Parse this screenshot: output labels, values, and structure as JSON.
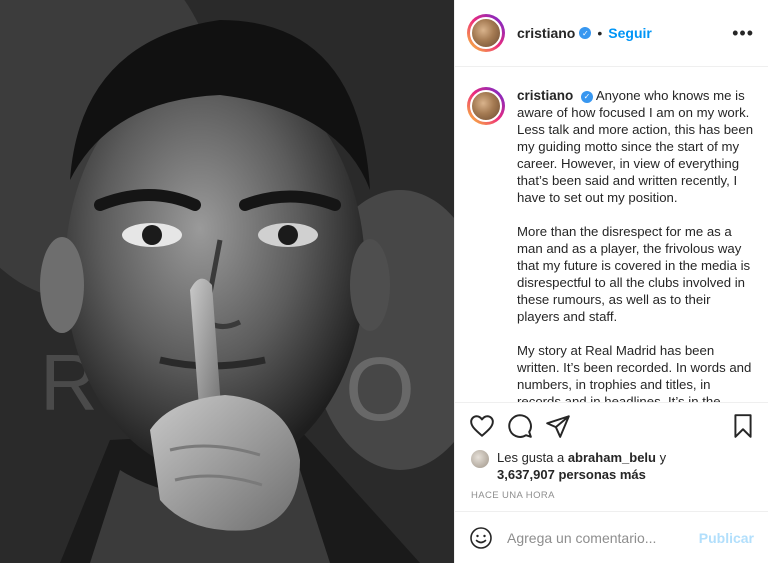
{
  "post": {
    "image_alt": "Photo of player in black and white with finger to lips"
  },
  "header": {
    "username": "cristiano",
    "separator": "•",
    "follow_label": "Seguir",
    "more_label": "•••",
    "verified_icon": "verified-badge-icon"
  },
  "caption": {
    "username": "cristiano",
    "paragraphs": [
      "Anyone who knows me is aware of how focused I am on my work. Less talk and more action, this has been my guiding motto since the start of my career. However, in view of everything that’s been said and written recently, I have to set out my position.",
      "More than the disrespect for me as a man and as a player, the frivolous way that my future is covered in the media is disrespectful to all the clubs involved in these rumours, as well as to their players and staff.",
      "My story at Real Madrid has been written. It’s been recorded. In words and numbers, in trophies and titles, in records and in headlines. It’s in the"
    ]
  },
  "actions": {
    "like_icon": "heart-icon",
    "comment_icon": "comment-icon",
    "share_icon": "paper-plane-icon",
    "save_icon": "bookmark-icon"
  },
  "likes": {
    "prefix": "Les gusta a ",
    "first_user": "abraham_belu",
    "conjunction": " y",
    "count_text": "3,637,907 personas más"
  },
  "timestamp": "HACE UNA HORA",
  "comment_box": {
    "placeholder": "Agrega un comentario...",
    "publish_label": "Publicar"
  },
  "colors": {
    "accent": "#0095f6",
    "publish_disabled": "#b2dffc",
    "verified": "#3897f0",
    "muted": "#8e8e8e"
  }
}
